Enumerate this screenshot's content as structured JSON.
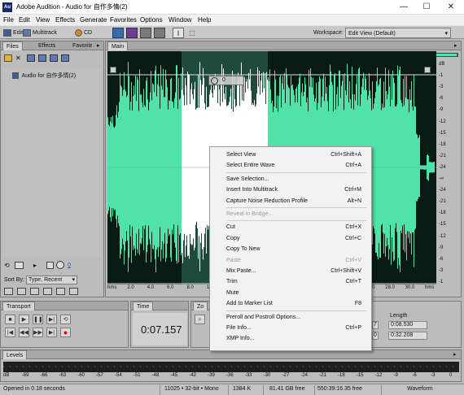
{
  "window": {
    "title": "Adobe Audition - Audio for 自作多情(2)",
    "app_icon": "Au",
    "minimize": "—",
    "maximize": "☐",
    "close": "✕"
  },
  "menu": [
    "File",
    "Edit",
    "View",
    "Effects",
    "Generate",
    "Favorites",
    "Options",
    "Window",
    "Help"
  ],
  "toolbar": {
    "edit": "Edit",
    "multitrack": "Multitrack",
    "cd": "CD",
    "workspace_label": "Workspace:",
    "workspace_value": "Edit View (Default)"
  },
  "files_panel": {
    "tabs": [
      "Files",
      "Effects",
      "Favorites"
    ],
    "item": "Audio for 自作多情(2)",
    "sort_label": "Sort By:",
    "sort_value": "Type, Recent",
    "zero": "0"
  },
  "main_panel": {
    "tab": "Main",
    "ruler_unit": "hms",
    "ruler": [
      "hms",
      "2.0",
      "4.0",
      "6.0",
      "8.0",
      "10.0",
      "12.0",
      "14.0",
      "16.0",
      "18.0",
      "20.0",
      "22.0",
      "24.0",
      "26.0",
      "28.0",
      "30.0",
      "hms"
    ],
    "db_scale": [
      "dB",
      "-1",
      "-3",
      "-6",
      "-9",
      "-12",
      "-15",
      "-18",
      "-21",
      "-24",
      "-∞",
      "-24",
      "-21",
      "-18",
      "-15",
      "-12",
      "-9",
      "-6",
      "-3",
      "-1"
    ]
  },
  "context_menu": [
    {
      "label": "Select View",
      "shortcut": "Ctrl+Shift+A",
      "disabled": false
    },
    {
      "label": "Select Entire Wave",
      "shortcut": "Ctrl+A",
      "disabled": false
    },
    {
      "sep": true
    },
    {
      "label": "Save Selection...",
      "shortcut": "",
      "disabled": false
    },
    {
      "label": "Insert Into Multitrack",
      "shortcut": "Ctrl+M",
      "disabled": false
    },
    {
      "label": "Capture Noise Reduction Profile",
      "shortcut": "Alt+N",
      "disabled": false
    },
    {
      "sep": true
    },
    {
      "label": "Reveal in Bridge...",
      "shortcut": "",
      "disabled": true
    },
    {
      "sep": true
    },
    {
      "label": "Cut",
      "shortcut": "Ctrl+X",
      "disabled": false
    },
    {
      "label": "Copy",
      "shortcut": "Ctrl+C",
      "disabled": false
    },
    {
      "label": "Copy To New",
      "shortcut": "",
      "disabled": false
    },
    {
      "label": "Paste",
      "shortcut": "Ctrl+V",
      "disabled": true
    },
    {
      "label": "Mix Paste...",
      "shortcut": "Ctrl+Shift+V",
      "disabled": false
    },
    {
      "label": "Trim",
      "shortcut": "Ctrl+T",
      "disabled": false
    },
    {
      "label": "Mute",
      "shortcut": "",
      "disabled": false
    },
    {
      "label": "Add to Marker List",
      "shortcut": "F8",
      "disabled": false
    },
    {
      "sep": true
    },
    {
      "label": "Preroll and Postroll Options...",
      "shortcut": "",
      "disabled": false
    },
    {
      "label": "File Info...",
      "shortcut": "Ctrl+P",
      "disabled": false
    },
    {
      "label": "XMP Info...",
      "shortcut": "",
      "disabled": false
    }
  ],
  "transport": {
    "tab": "Transport"
  },
  "time": {
    "tab": "Time",
    "value": "0:07.157"
  },
  "zoom": {
    "tab": "Zo"
  },
  "selection": {
    "length_label": "Length",
    "end_partial": "7",
    "end2_partial": "0",
    "length1": "0:08.530",
    "length2": "0:32.208"
  },
  "levels": {
    "tab": "Levels",
    "scale": [
      "dB",
      "-69",
      "-66",
      "-63",
      "-60",
      "-57",
      "-54",
      "-51",
      "-48",
      "-45",
      "-42",
      "-39",
      "-36",
      "-33",
      "-30",
      "-27",
      "-24",
      "-21",
      "-18",
      "-15",
      "-12",
      "-9",
      "-6",
      "-3",
      "0"
    ]
  },
  "status": {
    "opened": "Opened in 0.18 seconds",
    "format": "11025 • 32-bit • Mono",
    "size": "1384 K",
    "free": "81.41 GB free",
    "time_free": "550:39:16.35 free",
    "view": "Waveform"
  },
  "colors": {
    "wave": "#4fe3a8",
    "wave_bg": "#071a14",
    "selection_bg": "#1d4a3a",
    "selection_wave": "#ffffff"
  }
}
